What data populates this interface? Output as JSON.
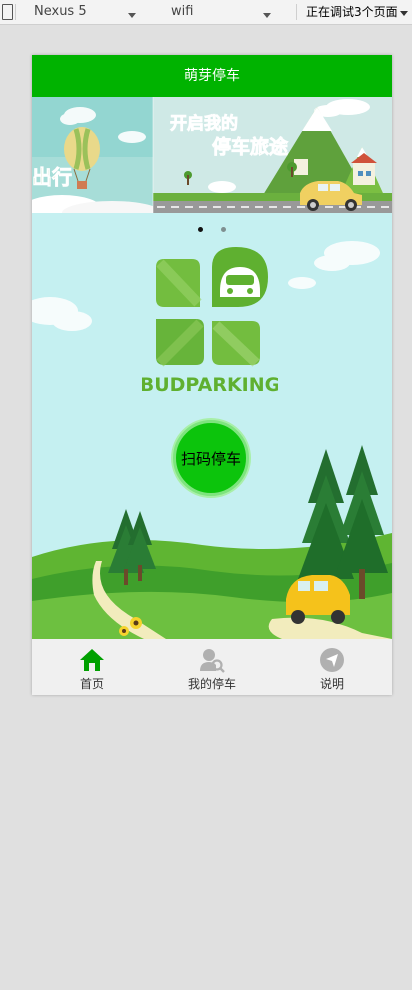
{
  "devtools": {
    "device": "Nexus 5",
    "network": "wifi",
    "status": "正在调试3个页面"
  },
  "app": {
    "title": "萌芽停车",
    "banner": {
      "left_text": "出行",
      "right_line1": "开启我的",
      "right_line2": "停车旅途",
      "active_slide": 0,
      "slide_count": 2
    },
    "logo_text": "BUDPARKING",
    "scan_label": "扫码停车",
    "tabs": [
      {
        "label": "首页",
        "icon": "home-icon",
        "active": true
      },
      {
        "label": "我的停车",
        "icon": "user-search-icon",
        "active": false
      },
      {
        "label": "说明",
        "icon": "navigation-arrow-icon",
        "active": false
      }
    ],
    "colors": {
      "header": "#00b300",
      "accent": "#0cc40c",
      "tab_active": "#00a000",
      "tab_inactive": "#b0b0b0",
      "sky": "#c5f0f1"
    }
  }
}
